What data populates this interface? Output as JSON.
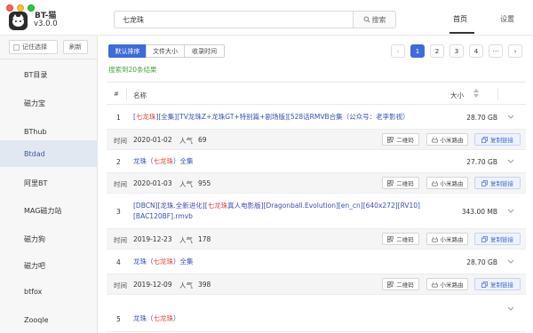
{
  "app": {
    "name": "BT-猫",
    "version": "v3.0.0"
  },
  "search": {
    "value": "七龙珠",
    "button_label": "搜索"
  },
  "nav": {
    "home": "首页",
    "settings": "设置"
  },
  "sidebar": {
    "remember_label": "记住选择",
    "refresh_label": "刷新",
    "items": [
      {
        "label": "BT目录"
      },
      {
        "label": "磁力宝"
      },
      {
        "label": "BThub"
      },
      {
        "label": "Btdad"
      },
      {
        "label": "阿里BT"
      },
      {
        "label": "MAG磁力站"
      },
      {
        "label": "磁力狗"
      },
      {
        "label": "磁力吧"
      },
      {
        "label": "btfox"
      },
      {
        "label": "Zooqle"
      }
    ],
    "active_index": 3
  },
  "sort_tabs": [
    {
      "label": "默认排序",
      "active": true
    },
    {
      "label": "文件大小",
      "active": false
    },
    {
      "label": "收录时间",
      "active": false
    }
  ],
  "result_summary": "搜索到20条结果",
  "pagination": {
    "prev": "‹",
    "pages": [
      "1",
      "2",
      "3",
      "4"
    ],
    "more": "···",
    "next": "›",
    "current": "1"
  },
  "table": {
    "col_num": "#",
    "col_name": "名称",
    "col_size": "大小",
    "detail_labels": {
      "time": "时间",
      "popularity": "人气"
    },
    "action_labels": {
      "qrcode": "二维码",
      "mi_router": "小米路由",
      "copy_link": "复制链接"
    },
    "rows": [
      {
        "num": "1",
        "title_parts": [
          "[",
          "七龙珠",
          "][全集][TV龙珠Z+龙珠GT+特别篇+剧场版][528话RMVB合集（公众号：老李影视）"
        ],
        "size": "28.70 GB",
        "time": "2020-01-02",
        "popularity": "69"
      },
      {
        "num": "2",
        "title_parts": [
          "龙珠（",
          "七龙珠",
          "）全集"
        ],
        "size": "27.70 GB",
        "time": "2020-01-03",
        "popularity": "955"
      },
      {
        "num": "3",
        "title_parts": [
          "[DBCN][龙珠.全新进化][",
          "七龙珠",
          "真人电影版][Dragonball.Evolution][en_cn][640x272][RV10][BAC120BF].rmvb"
        ],
        "size": "343.00 MB",
        "time": "2019-12-23",
        "popularity": "178"
      },
      {
        "num": "4",
        "title_parts": [
          "龙珠（",
          "七龙珠",
          "）全集"
        ],
        "size": "28.70 GB",
        "time": "2019-12-09",
        "popularity": "398"
      },
      {
        "num": "5",
        "title_parts": [
          "龙珠（",
          "七龙珠",
          "）"
        ],
        "size": "",
        "time": "",
        "popularity": ""
      }
    ]
  },
  "colors": {
    "accent": "#3f6ad8",
    "highlight": "#e0433b",
    "link": "#3a4fb8",
    "result_green": "#49a83d"
  }
}
